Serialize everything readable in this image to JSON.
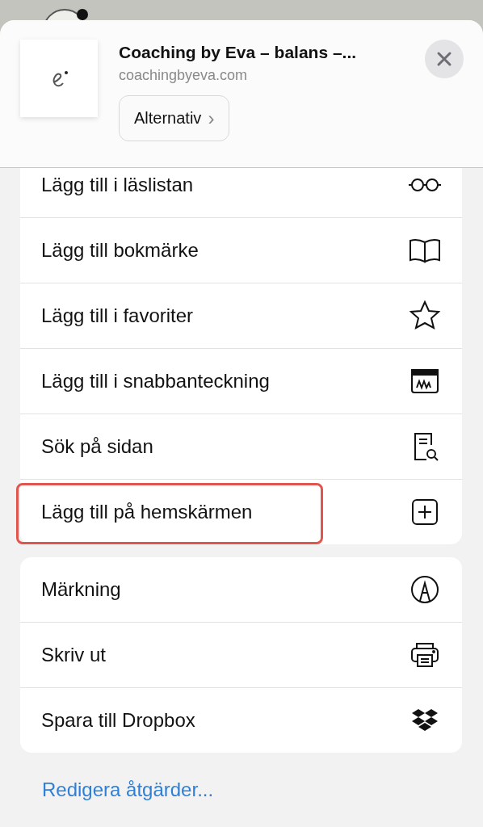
{
  "header": {
    "title": "Coaching by Eva – balans –...",
    "url": "coachingbyeva.com",
    "options_button": "Alternativ",
    "options_chevron": "›"
  },
  "groups": [
    {
      "items": [
        {
          "label": "Lägg till i läslistan",
          "highlighted": false
        },
        {
          "label": "Lägg till bokmärke",
          "highlighted": false
        },
        {
          "label": "Lägg till i favoriter",
          "highlighted": false
        },
        {
          "label": "Lägg till i snabbanteckning",
          "highlighted": false
        },
        {
          "label": "Sök på sidan",
          "highlighted": false
        },
        {
          "label": "Lägg till på hemskärmen",
          "highlighted": true
        }
      ]
    },
    {
      "items": [
        {
          "label": "Märkning",
          "highlighted": false
        },
        {
          "label": "Skriv ut",
          "highlighted": false
        },
        {
          "label": "Spara till Dropbox",
          "highlighted": false
        }
      ]
    }
  ],
  "edit_link": "Redigera åtgärder..."
}
